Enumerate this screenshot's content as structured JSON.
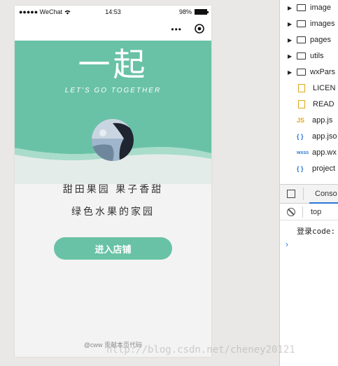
{
  "status_bar": {
    "carrier": "●●●●● WeChat",
    "time": "14:53",
    "battery": "98%",
    "battery_level": 0.98
  },
  "nav_bar": {
    "title": "",
    "more_label": "•••"
  },
  "banner": {
    "title": "一起",
    "subtitle": "LET'S GO TOGETHER"
  },
  "slogan": {
    "line1": "甜田果园 果子香甜",
    "line2": "绿色水果的家园"
  },
  "enter_button": {
    "label": "进入店铺"
  },
  "footer": {
    "credit": "@cww 贡献本页代码"
  },
  "file_tree": [
    {
      "kind": "folder",
      "name": "image"
    },
    {
      "kind": "folder",
      "name": "images"
    },
    {
      "kind": "folder",
      "name": "pages"
    },
    {
      "kind": "folder",
      "name": "utils"
    },
    {
      "kind": "folder",
      "name": "wxPars"
    },
    {
      "kind": "doc",
      "name": "LICEN"
    },
    {
      "kind": "doc",
      "name": "READ"
    },
    {
      "kind": "js",
      "tag": "JS",
      "name": "app.js"
    },
    {
      "kind": "json",
      "tag": "{ }",
      "name": "app.jso"
    },
    {
      "kind": "wxss",
      "tag": "wxss",
      "name": "app.wx"
    },
    {
      "kind": "json",
      "tag": "{ }",
      "name": "project"
    }
  ],
  "console": {
    "tab_label": "Conso",
    "context": "top",
    "log_line": "登录code:",
    "prompt": "›"
  },
  "watermark": "http://blog.csdn.net/cheney20121",
  "colors": {
    "brand_green": "#69c2a5",
    "accent_blue": "#2b78d6"
  }
}
